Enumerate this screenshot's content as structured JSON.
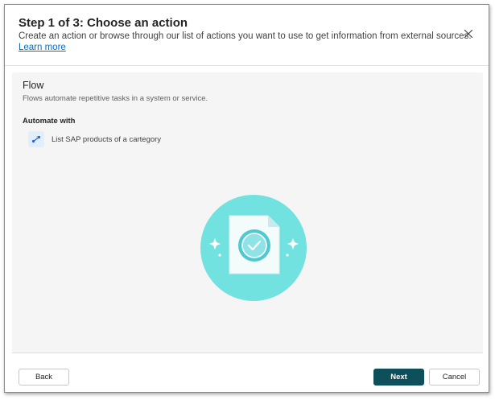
{
  "dialog": {
    "title": "Step 1 of 3: Choose an action",
    "subtitle": "Create an action or browse through our list of actions you want to use to get information from external sources.",
    "learn_more": "Learn more",
    "close_icon": "close-icon"
  },
  "section": {
    "title": "Flow",
    "description": "Flows automate repetitive tasks in a system or service.",
    "automate_heading": "Automate with",
    "items": [
      {
        "label": "List SAP products of a cartegory",
        "icon": "flow-icon"
      }
    ],
    "illustration_icon": "document-check-icon"
  },
  "footer": {
    "back_label": "Back",
    "next_label": "Next",
    "cancel_label": "Cancel"
  },
  "colors": {
    "accent": "#0e4f5c",
    "link": "#0f6cbd",
    "illustration_circle": "#6fe0de"
  }
}
